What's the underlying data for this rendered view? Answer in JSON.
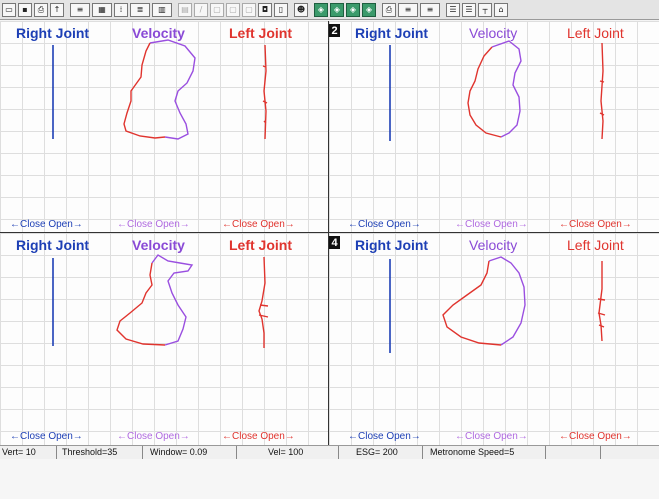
{
  "toolbar": {
    "buttons": [
      {
        "icon": "open-icon",
        "glyph": "▭"
      },
      {
        "icon": "save-icon",
        "glyph": "▪"
      },
      {
        "icon": "print-setup-icon",
        "glyph": "⎙"
      },
      {
        "icon": "up-arrow-icon",
        "glyph": "↑"
      },
      {
        "icon": "scan-icon",
        "glyph": "≡"
      },
      {
        "icon": "tool-icon",
        "glyph": "▦"
      },
      {
        "icon": "grid-icon",
        "glyph": "⁞"
      },
      {
        "icon": "label-icon",
        "glyph": "≣"
      },
      {
        "icon": "bars-icon",
        "glyph": "▥"
      },
      {
        "icon": "chart-icon",
        "glyph": "▤"
      },
      {
        "icon": "pen-icon",
        "glyph": "/"
      },
      {
        "icon": "window-icon",
        "glyph": "▢"
      },
      {
        "icon": "window2-icon",
        "glyph": "▢"
      },
      {
        "icon": "window3-icon",
        "glyph": "▢"
      },
      {
        "icon": "cut-icon",
        "glyph": "◘"
      },
      {
        "icon": "marker-icon",
        "glyph": "▯"
      },
      {
        "icon": "person-icon",
        "glyph": "☻"
      },
      {
        "icon": "layer1-icon",
        "glyph": "◈"
      },
      {
        "icon": "layer2-icon",
        "glyph": "◈"
      },
      {
        "icon": "layer3-icon",
        "glyph": "◈"
      },
      {
        "icon": "layer4-icon",
        "glyph": "◈"
      },
      {
        "icon": "printer-icon",
        "glyph": "⎙"
      },
      {
        "icon": "sub-scale-icon",
        "glyph": "≡"
      },
      {
        "icon": "setup-icon",
        "glyph": "≡"
      },
      {
        "icon": "align-icon",
        "glyph": "☰"
      },
      {
        "icon": "lines-icon",
        "glyph": "☰"
      },
      {
        "icon": "split-icon",
        "glyph": "┬"
      },
      {
        "icon": "home-icon",
        "glyph": "⌂"
      }
    ]
  },
  "labels": {
    "right_joint": "Right Joint",
    "velocity": "Velocity",
    "left_joint": "Left Joint",
    "foot_right": "←Close  Open→",
    "foot_vel": "←Close  Open→",
    "foot_left": "←Close  Open→"
  },
  "panels": [
    {
      "number": ""
    },
    {
      "number": "2"
    },
    {
      "number": ""
    },
    {
      "number": "4"
    }
  ],
  "status": {
    "vert": "Vert= 10",
    "threshold": "Threshold=35",
    "window": "Window= 0.09",
    "vel": "Vel= 100",
    "esg": "ESG= 200",
    "metronome": "Metronome Speed=5"
  },
  "colors": {
    "right_joint": "#1d3fb5",
    "velocity_close": "#e0342e",
    "velocity_open": "#9a4fe0",
    "left_joint": "#e0342e"
  }
}
